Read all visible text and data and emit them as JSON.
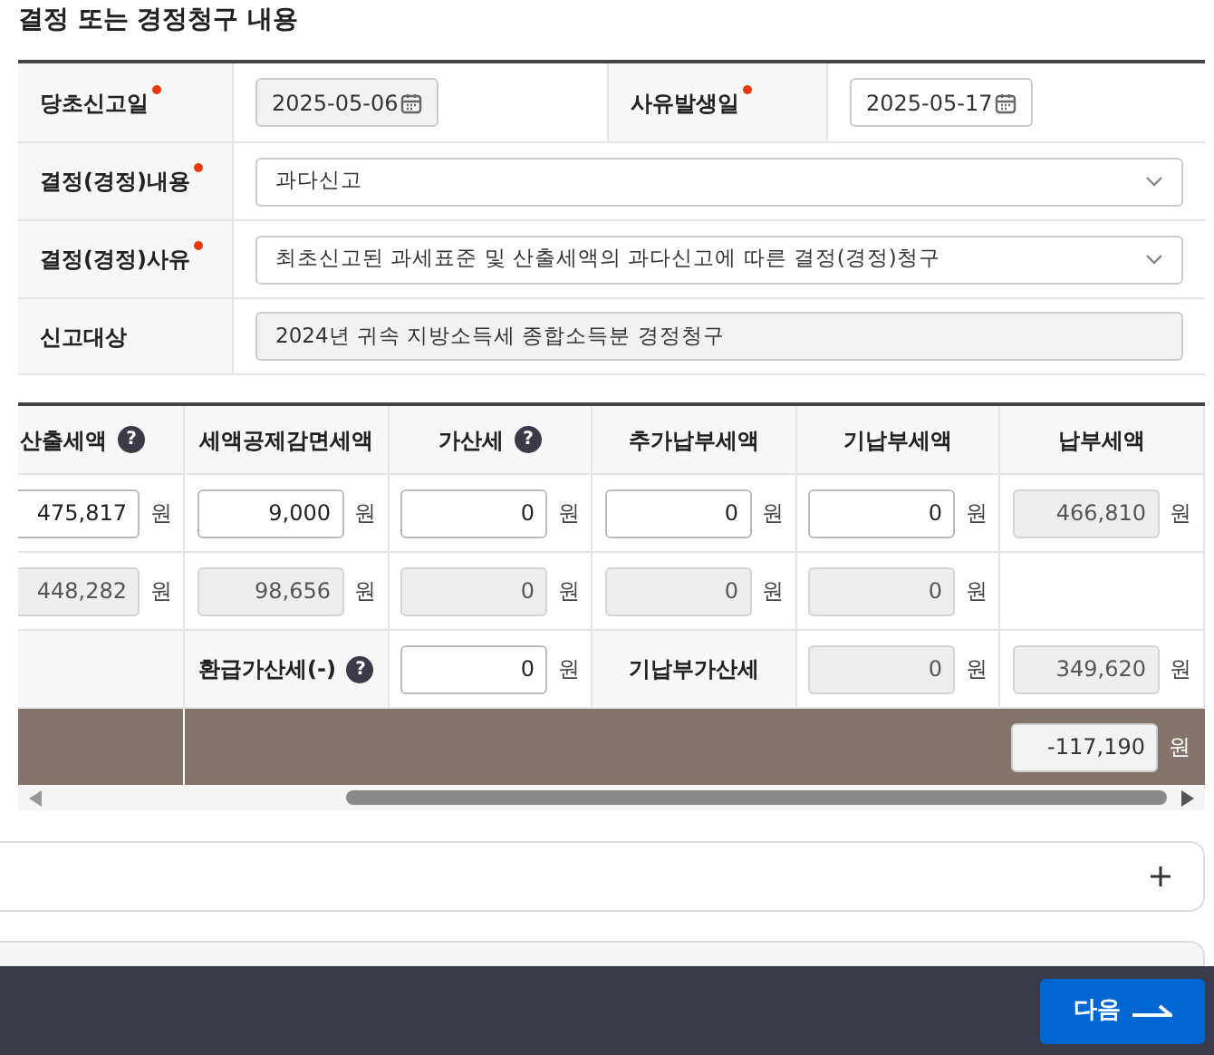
{
  "section_title": "결정 또는 경정청구 내용",
  "form": [
    {
      "kind": "dates",
      "cells": [
        {
          "label": "당초신고일",
          "required": true,
          "value": "2025-05-06",
          "disabled": true
        },
        {
          "label": "사유발생일",
          "required": true,
          "value": "2025-05-17",
          "disabled": false
        }
      ]
    },
    {
      "kind": "select",
      "label": "결정(경정)내용",
      "required": true,
      "value": "과다신고"
    },
    {
      "kind": "select",
      "label": "결정(경정)사유",
      "required": true,
      "value": "최초신고된 과세표준 및 산출세액의 과다신고에 따른 결정(경정)청구"
    },
    {
      "kind": "readonly",
      "label": "신고대상",
      "value": "2024년 귀속 지방소득세 종합소득분 경정청구"
    }
  ],
  "table": {
    "columns": [
      {
        "label": "산출세액",
        "help": "?"
      },
      {
        "label": "세액공제감면세액"
      },
      {
        "label": "가산세",
        "help": "?"
      },
      {
        "label": "추가납부세액"
      },
      {
        "label": "기납부세액"
      },
      {
        "label": "납부세액"
      }
    ],
    "rows": [
      [
        {
          "kind": "input",
          "value": "475,817",
          "unit": "원",
          "disabled": false
        },
        {
          "kind": "input",
          "value": "9,000",
          "unit": "원",
          "disabled": false
        },
        {
          "kind": "input",
          "value": "0",
          "unit": "원",
          "disabled": false
        },
        {
          "kind": "input",
          "value": "0",
          "unit": "원",
          "disabled": false
        },
        {
          "kind": "input",
          "value": "0",
          "unit": "원",
          "disabled": false
        },
        {
          "kind": "input",
          "value": "466,810",
          "unit": "원",
          "disabled": true
        }
      ],
      [
        {
          "kind": "input",
          "value": "448,282",
          "unit": "원",
          "disabled": true
        },
        {
          "kind": "input",
          "value": "98,656",
          "unit": "원",
          "disabled": true
        },
        {
          "kind": "input",
          "value": "0",
          "unit": "원",
          "disabled": true
        },
        {
          "kind": "input",
          "value": "0",
          "unit": "원",
          "disabled": true
        },
        {
          "kind": "input",
          "value": "0",
          "unit": "원",
          "disabled": true
        },
        {
          "kind": "empty"
        }
      ],
      [
        {
          "kind": "empty"
        },
        {
          "kind": "label",
          "text": "환급가산세(-)",
          "help": "?"
        },
        {
          "kind": "input",
          "value": "0",
          "unit": "원",
          "disabled": false
        },
        {
          "kind": "label",
          "text": "기납부가산세"
        },
        {
          "kind": "input",
          "value": "0",
          "unit": "원",
          "disabled": true
        },
        {
          "kind": "input",
          "value": "349,620",
          "unit": "원",
          "disabled": true
        }
      ]
    ],
    "total": {
      "value": "-117,190",
      "unit": "원"
    }
  },
  "sections": [
    {
      "expanded": false
    }
  ],
  "partial_section": true,
  "next_button": "다음"
}
